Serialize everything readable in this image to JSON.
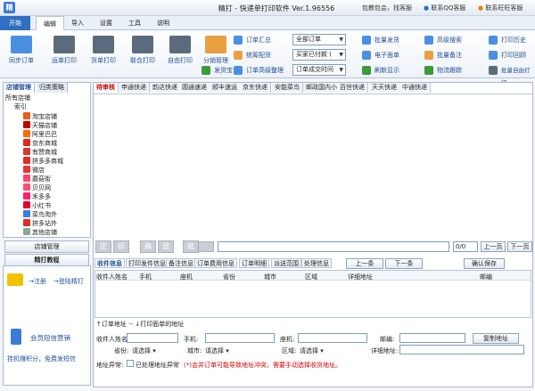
{
  "window": {
    "title": "精打 - 快递单打印软件 Ver.1.96556",
    "logo": "精",
    "links": [
      "包教包会，找客服",
      "联系QQ客服",
      "联系旺旺客服"
    ],
    "controls": [
      "—",
      "▭",
      "✕"
    ]
  },
  "menu": [
    "开始",
    "编辑",
    "导入",
    "设置",
    "工具",
    "说明"
  ],
  "ribbon": {
    "big": [
      "同步订单",
      "运单打印",
      "货单打印",
      "联合打印",
      "自由打印",
      "分销管理"
    ],
    "small_col1": [
      "订单汇总",
      "统筹配货",
      "订单高级整理"
    ],
    "combo": [
      "全部订单",
      "买家已付款 (",
      "订单成交时间"
    ],
    "fahuo": "发货宝",
    "col3": [
      "批量发货",
      "电子面单",
      "刷新显示"
    ],
    "col4": [
      "高级搜索",
      "批量备注",
      "物流跟踪"
    ],
    "col5": [
      "打印历史",
      "打印回顾",
      "批量自由打印"
    ]
  },
  "left": {
    "tabs": [
      "店铺管理",
      "归类策略"
    ],
    "tree": [
      "所有店铺",
      "索引",
      "淘宝店铺",
      "天猫店铺",
      "阿里巴巴",
      "京东商城",
      "有赞商城",
      "拼多多商城",
      "微店",
      "蘑菇街",
      "贝贝网",
      "禾多多",
      "小红书",
      "菜鸟淘外",
      "拼多站外",
      "其他店铺"
    ],
    "btn1": "店铺管理",
    "btn2": "精打教程",
    "reg": [
      "注册",
      "登陆精打"
    ],
    "sms": "会员短信营销",
    "points": "挂机赚积分，免费发短信"
  },
  "express_tabs": [
    "待审核",
    "申通快递",
    "韵达快递",
    "圆通速递",
    "顺丰速运",
    "京东快递",
    "安能菜鸟",
    "邮政国内小包",
    "百世快递",
    "天天快递",
    "中通快递"
  ],
  "tools": [
    "正",
    "印",
    "确",
    "显",
    "批"
  ],
  "pager": {
    "count": "0/0",
    "prev": "上一页",
    "next": "下一页"
  },
  "info_tabs": [
    "收件信息",
    "打印发件信息",
    "备注信息",
    "订单费用信息",
    "订单明细",
    "派送范围",
    "处理信息"
  ],
  "nav": {
    "prev": "上一条",
    "next": "下一条",
    "save": "确认保存"
  },
  "columns": [
    "收件人姓名",
    "手机",
    "座机",
    "省份",
    "城市",
    "区域",
    "详细地址",
    "邮编"
  ],
  "tip": "↑订单地址 -- ↓打印面单的地址",
  "form": {
    "name": "收件人姓名:",
    "phone": "手机:",
    "tel": "座机:",
    "zip": "邮编:",
    "copy": "复制地址",
    "prov": "省份:",
    "city": "城市:",
    "area": "区域:",
    "detail": "详细地址:",
    "select": "请选择"
  },
  "warn": {
    "label": "地址异常:",
    "check": "已处理地址异常",
    "text": "(*)会并订单可能导致地址冲突，需要手动选择收货地址。"
  },
  "colors": {
    "accent": "#2f6fc2",
    "link": "#1f4e99",
    "warn": "#d00000"
  }
}
